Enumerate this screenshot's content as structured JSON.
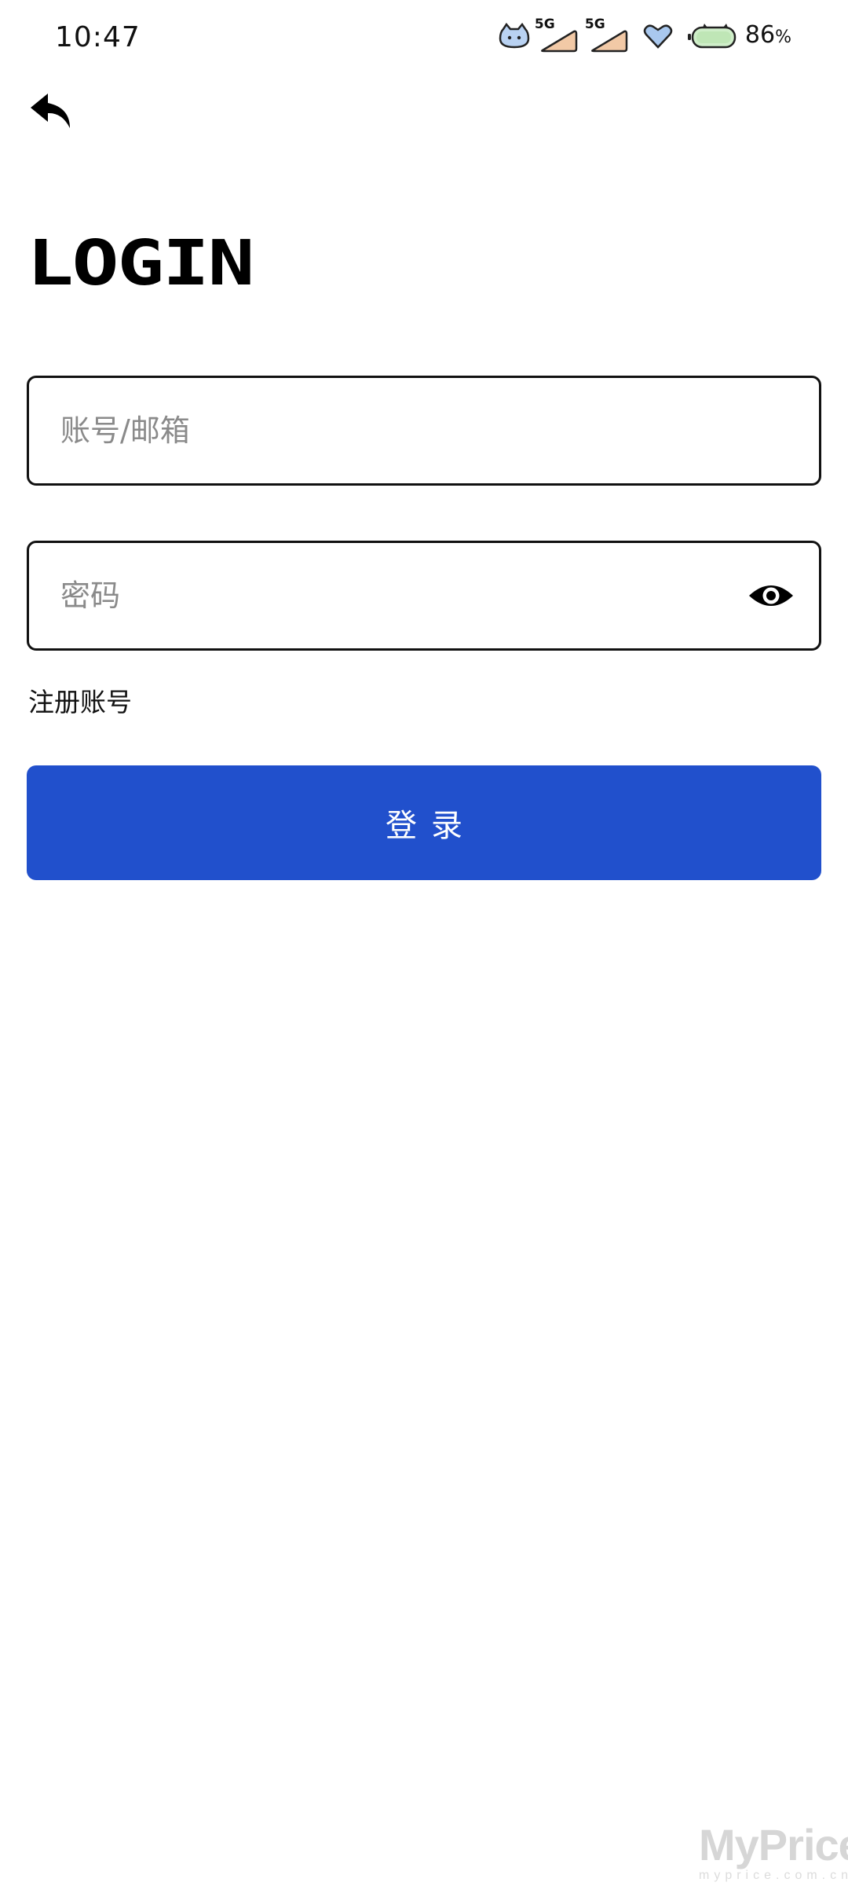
{
  "status_bar": {
    "time": "10:47",
    "network_1": "5G",
    "network_2": "5G",
    "battery_percent": "86",
    "battery_sign": "%"
  },
  "header": {
    "back_icon": "back-arrow-icon"
  },
  "title": "LOGIN",
  "form": {
    "account": {
      "placeholder": "账号/邮箱",
      "value": ""
    },
    "password": {
      "placeholder": "密码",
      "value": "",
      "toggle_icon": "eye-icon"
    },
    "register_label": "注册账号",
    "login_label": "登录"
  },
  "watermark": {
    "title": "MyPrice",
    "subtitle": "myprice.com.cn"
  },
  "colors": {
    "primary": "#2150cc",
    "border": "#111111",
    "placeholder": "#8a8a8a",
    "background": "#ffffff"
  }
}
